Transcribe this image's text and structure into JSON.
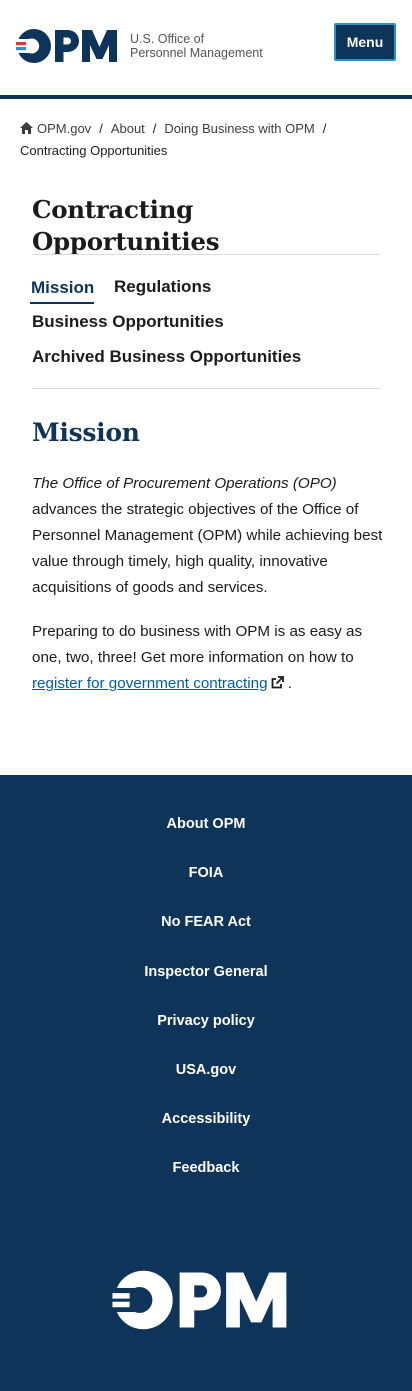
{
  "header": {
    "logo_text": "OPM",
    "agency_line1": "U.S. Office of",
    "agency_line2": "Personnel Management",
    "menu_label": "Menu"
  },
  "breadcrumb": {
    "items": [
      "OPM.gov",
      "About",
      "Doing Business with OPM"
    ],
    "current": "Contracting Opportunities"
  },
  "page": {
    "title": "Contracting Opportunities"
  },
  "subnav": {
    "items": [
      "Mission",
      "Regulations",
      "Business Opportunities",
      "Archived Business Opportunities"
    ],
    "active": "Mission"
  },
  "mission": {
    "heading": "Mission",
    "para1_italic": "The Office of Procurement Operations (OPO)",
    "para1_rest": " advances the strategic objectives of the Office of Personnel Management (OPM) while achieving best value through timely, high quality, innovative acquisitions of goods and services.",
    "para2_text": "Preparing to do business with OPM is as easy as one, two, three! Get more information on how to ",
    "para2_link": "register for government contracting",
    "para2_end": "."
  },
  "footer": {
    "links": [
      "About OPM",
      "FOIA",
      "No FEAR Act",
      "Inspector General",
      "Privacy policy",
      "USA.gov",
      "Accessibility",
      "Feedback"
    ]
  },
  "colors": {
    "navy": "#0e3559",
    "link": "#005ea2",
    "logo_red": "#d83933",
    "logo_blue": "#2e90c9"
  },
  "icons": [
    "home-icon",
    "external-link-icon"
  ]
}
